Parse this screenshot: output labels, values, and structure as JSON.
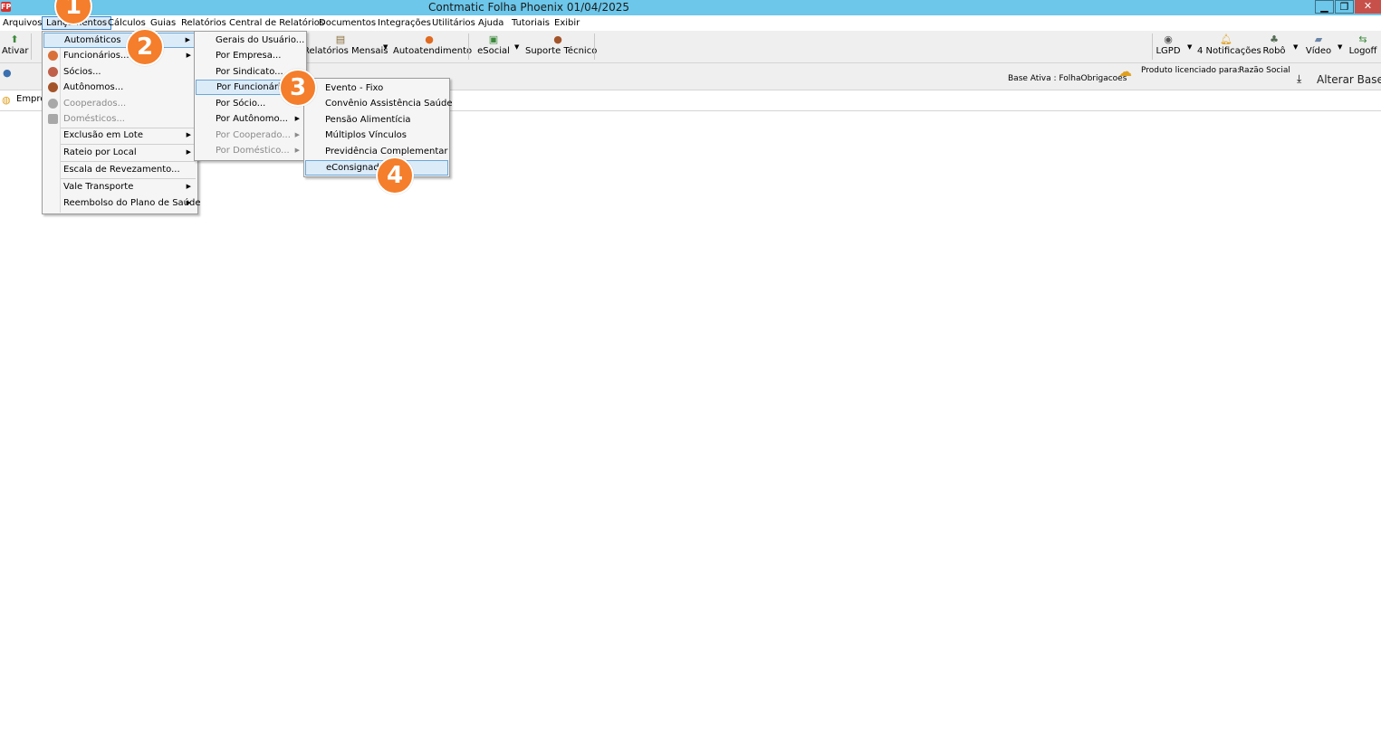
{
  "window": {
    "title": "Contmatic Folha Phoenix 01/04/2025",
    "app_icon": "FP",
    "minimize": "▁",
    "maximize": "❐",
    "close": "✕"
  },
  "menubar": {
    "items": [
      "Arquivos",
      "Lançamentos",
      "Cálculos",
      "Guias",
      "Relatórios",
      "Central de Relatórios",
      "Documentos",
      "Integrações",
      "Utilitários",
      "Ajuda",
      "Tutoriais",
      "Exibir"
    ],
    "active": "Lançamentos"
  },
  "toolbar": {
    "left": [
      {
        "label": "Ativar",
        "icon": "activate-icon"
      }
    ],
    "middle": [
      {
        "label": "Relatórios Mensais",
        "icon": "report-icon"
      },
      {
        "label": "Autoatendimento",
        "icon": "help-icon"
      },
      {
        "label": "eSocial",
        "icon": "esocial-icon"
      },
      {
        "label": "Suporte Técnico",
        "icon": "support-icon"
      }
    ],
    "right": [
      {
        "label": "LGPD",
        "icon": "eye-icon"
      },
      {
        "label": "4 Notificações",
        "icon": "bell-icon"
      },
      {
        "label": "Robô",
        "icon": "robot-icon"
      },
      {
        "label": "Vídeo",
        "icon": "video-icon"
      },
      {
        "label": "Logoff",
        "icon": "logoff-icon"
      }
    ]
  },
  "infobar": {
    "base_label": "Base Ativa : FolhaObrigacoes",
    "licensed_label": "Produto licenciado para:",
    "licensed_value": "Razão Social",
    "alter_base": "Alterar Base"
  },
  "tab": {
    "label": "Empre"
  },
  "menu_lancamentos": {
    "items": [
      {
        "label": "Automáticos",
        "submenu": true,
        "highlight": true
      },
      {
        "label": "Funcionários...",
        "submenu": true,
        "icon": "person-icon"
      },
      {
        "label": "Sócios...",
        "icon": "person-icon"
      },
      {
        "label": "Autônomos...",
        "icon": "person-icon"
      },
      {
        "label": "Cooperados...",
        "disabled": true,
        "icon": "person-gray-icon"
      },
      {
        "label": "Domésticos...",
        "disabled": true,
        "icon": "home-gray-icon"
      },
      {
        "label": "Exclusão em Lote",
        "submenu": true
      },
      {
        "label": "Rateio por Local",
        "submenu": true
      },
      {
        "label": "Escala de Revezamento..."
      },
      {
        "label": "Vale Transporte",
        "submenu": true
      },
      {
        "label": "Reembolso do Plano de Saúde",
        "submenu": true
      }
    ]
  },
  "menu_automaticos": {
    "items": [
      {
        "label": "Gerais do Usuário..."
      },
      {
        "label": "Por Empresa..."
      },
      {
        "label": "Por Sindicato..."
      },
      {
        "label": "Por Funcionário...",
        "submenu": true,
        "highlight": true
      },
      {
        "label": "Por Sócio..."
      },
      {
        "label": "Por Autônomo...",
        "submenu": true
      },
      {
        "label": "Por Cooperado...",
        "submenu": true,
        "disabled": true
      },
      {
        "label": "Por Doméstico...",
        "submenu": true,
        "disabled": true
      }
    ]
  },
  "menu_funcionario": {
    "items": [
      {
        "label": "Evento - Fixo"
      },
      {
        "label": "Convênio Assistência Saúde"
      },
      {
        "label": "Pensão Alimentícia"
      },
      {
        "label": "Múltiplos Vínculos"
      },
      {
        "label": "Previdência Complementar"
      },
      {
        "label": "eConsignado",
        "highlight": true
      }
    ]
  },
  "steps": [
    "1",
    "2",
    "3",
    "4"
  ],
  "colors": {
    "titlebar": "#6cc7ea",
    "badge": "#f47e2b",
    "highlight": "#dcebf8"
  }
}
